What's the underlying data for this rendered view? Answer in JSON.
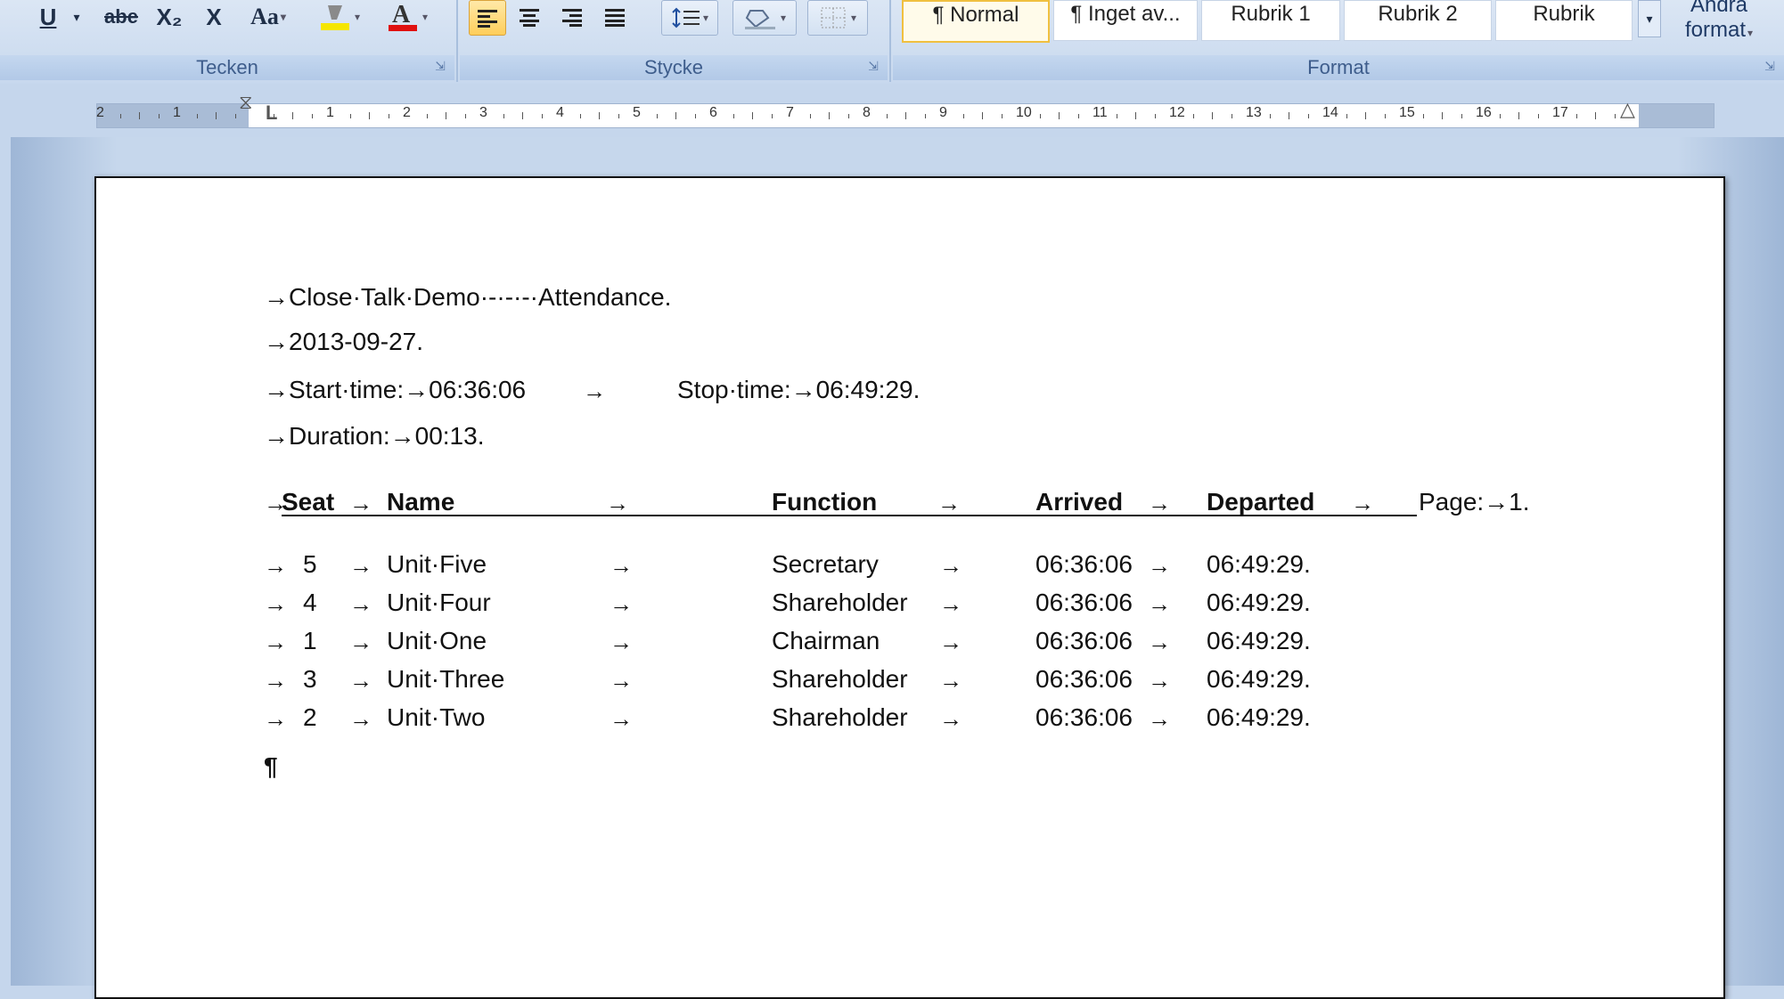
{
  "ribbon": {
    "tecken": {
      "label": "Tecken",
      "buttons": [
        "U",
        "abe",
        "X₂",
        "X",
        "Aa"
      ],
      "highlight_color": "#f5e600",
      "font_color": "#e01010"
    },
    "stycke": {
      "label": "Stycke"
    },
    "format": {
      "label": "Format",
      "styles": [
        "¶ Normal",
        "¶ Inget av...",
        "Rubrik 1",
        "Rubrik 2",
        "Rubrik"
      ],
      "change_styles": {
        "line1": "Ändra",
        "line2": "format"
      }
    }
  },
  "ruler": {
    "labels": [
      "2",
      "1",
      "1",
      "2",
      "3",
      "4",
      "5",
      "6",
      "7",
      "8",
      "9",
      "10",
      "11",
      "12",
      "13",
      "14",
      "15",
      "16",
      "17"
    ]
  },
  "document": {
    "title_line": "Close·Talk·Demo·-·-·-·Attendance.",
    "date": "2013-09-27.",
    "start_label": "Start·time:",
    "start_value": "06:36:06",
    "stop_label": "Stop·time:",
    "stop_value": "06:49:29.",
    "duration_label": "Duration:",
    "duration_value": "00:13.",
    "headers": {
      "seat": "Seat",
      "name": "Name",
      "function": "Function",
      "arrived": "Arrived",
      "departed": "Departed",
      "page_label": "Page:",
      "page_value": "1."
    },
    "rows": [
      {
        "seat": "5",
        "name": "Unit·Five",
        "function": "Secretary",
        "arrived": "06:36:06",
        "departed": "06:49:29."
      },
      {
        "seat": "4",
        "name": "Unit·Four",
        "function": "Shareholder",
        "arrived": "06:36:06",
        "departed": "06:49:29."
      },
      {
        "seat": "1",
        "name": "Unit·One",
        "function": "Chairman",
        "arrived": "06:36:06",
        "departed": "06:49:29."
      },
      {
        "seat": "3",
        "name": "Unit·Three",
        "function": "Shareholder",
        "arrived": "06:36:06",
        "departed": "06:49:29."
      },
      {
        "seat": "2",
        "name": "Unit·Two",
        "function": "Shareholder",
        "arrived": "06:36:06",
        "departed": "06:49:29."
      }
    ],
    "pilcrow": "¶",
    "tab_glyph": "→"
  }
}
